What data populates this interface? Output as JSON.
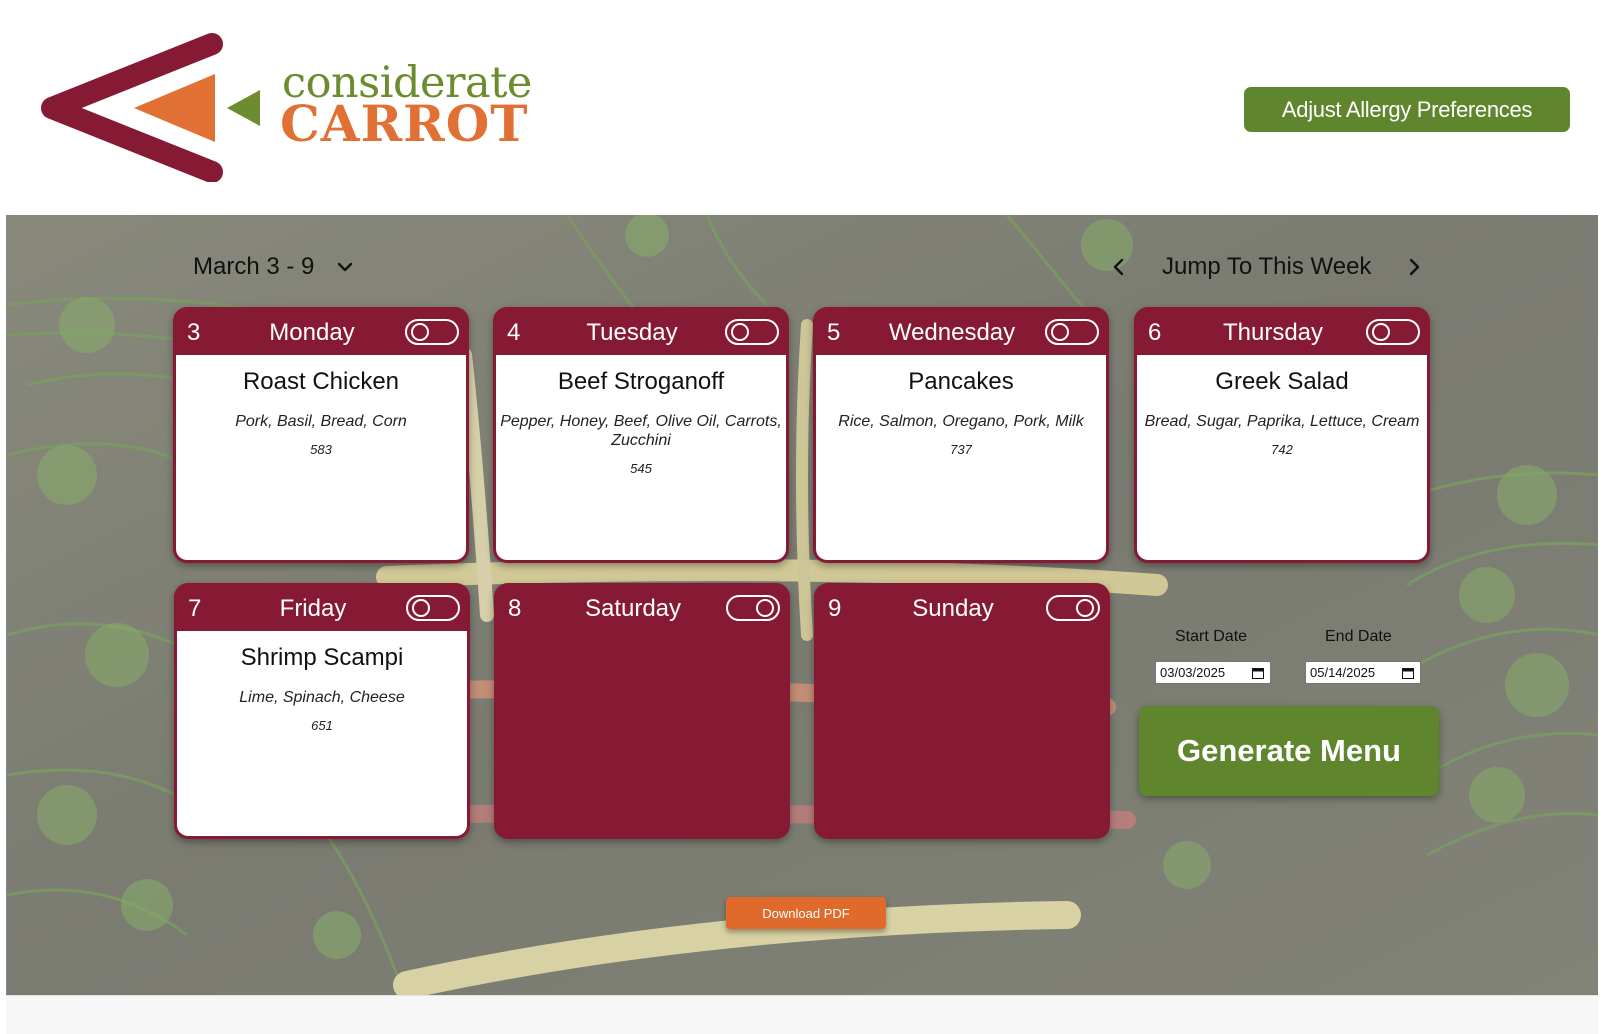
{
  "brand": {
    "name_line_1": "considerate",
    "name_line_2": "CARROT",
    "colors": {
      "maroon": "#861a35",
      "orange": "#e07033",
      "green": "#6b8c2f"
    }
  },
  "header": {
    "allergy_button": "Adjust Allergy Preferences"
  },
  "week_bar": {
    "range_label": "March 3 - 9",
    "jump_label": "Jump To This Week",
    "icons": {
      "dropdown": "chevron-down-icon",
      "prev": "chevron-left-icon",
      "next": "chevron-right-icon"
    }
  },
  "days": [
    {
      "num": "3",
      "name": "Monday",
      "enabled": false,
      "meal": "Roast Chicken",
      "ingredients": "Pork, Basil, Bread, Corn",
      "calories": "583"
    },
    {
      "num": "4",
      "name": "Tuesday",
      "enabled": false,
      "meal": "Beef Stroganoff",
      "ingredients": "Pepper, Honey, Beef, Olive Oil, Carrots, Zucchini",
      "calories": "545"
    },
    {
      "num": "5",
      "name": "Wednesday",
      "enabled": false,
      "meal": "Pancakes",
      "ingredients": "Rice, Salmon, Oregano, Pork, Milk",
      "calories": "737"
    },
    {
      "num": "6",
      "name": "Thursday",
      "enabled": false,
      "meal": "Greek Salad",
      "ingredients": "Bread, Sugar, Paprika, Lettuce, Cream",
      "calories": "742"
    },
    {
      "num": "7",
      "name": "Friday",
      "enabled": false,
      "meal": "Shrimp Scampi",
      "ingredients": "Lime, Spinach, Cheese",
      "calories": "651"
    },
    {
      "num": "8",
      "name": "Saturday",
      "enabled": true
    },
    {
      "num": "9",
      "name": "Sunday",
      "enabled": true
    }
  ],
  "date_range": {
    "start_label": "Start Date",
    "start_value": "03/03/2025",
    "end_label": "End Date",
    "end_value": "05/14/2025"
  },
  "actions": {
    "generate": "Generate Menu",
    "download_pdf": "Download PDF"
  }
}
